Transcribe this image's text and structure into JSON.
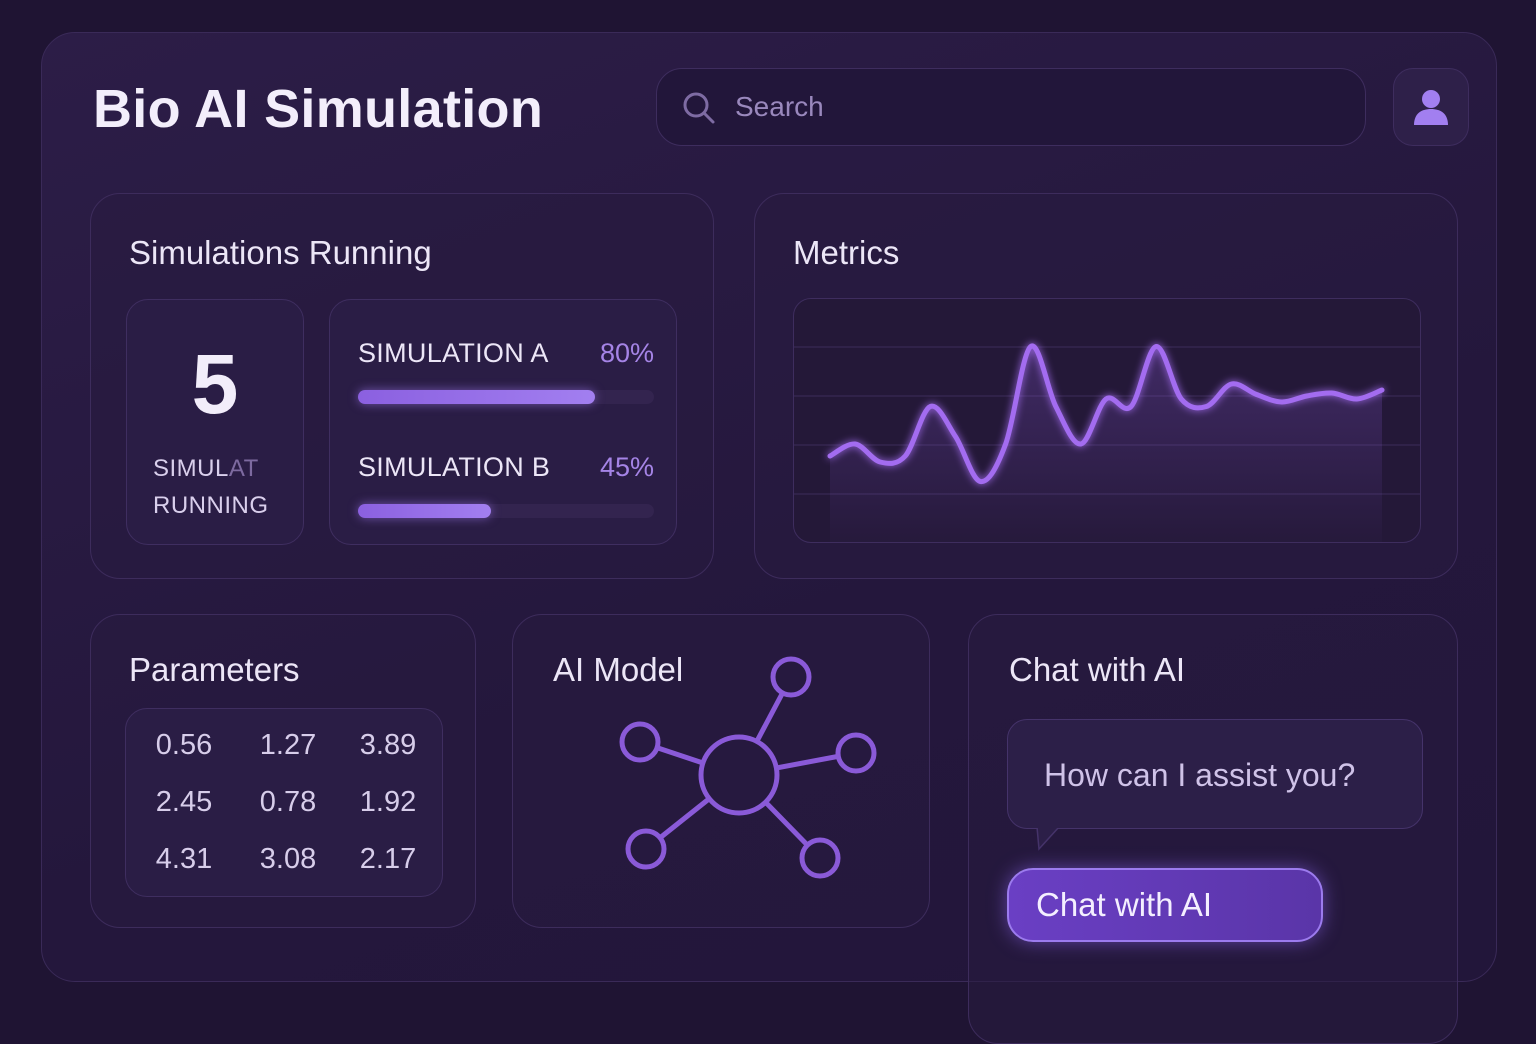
{
  "app": {
    "title": "Bio AI Simulation"
  },
  "search": {
    "placeholder": "Search",
    "icon": "search-icon"
  },
  "profile": {
    "icon": "user-icon"
  },
  "simulations": {
    "title": "Simulations Running",
    "count": "5",
    "count_label_line1_a": "SIMUL",
    "count_label_line1_b": "AT",
    "count_label_line2": "RUNNING",
    "items": [
      {
        "name": "SIMULATION A",
        "percent_label": "80%",
        "progress": 0.8
      },
      {
        "name": "SIMULATION B",
        "percent_label": "45%",
        "progress": 0.45
      }
    ]
  },
  "metrics": {
    "title": "Metrics",
    "chart_data": {
      "type": "line",
      "title": "",
      "xlabel": "",
      "ylabel": "",
      "grid": true,
      "x": [
        0,
        1,
        2,
        3,
        4,
        5,
        6,
        7,
        8,
        9,
        10,
        11,
        12,
        13,
        14,
        15,
        16,
        17,
        18,
        19,
        20,
        21,
        22
      ],
      "series": [
        {
          "values": [
            0.22,
            0.3,
            0.18,
            0.22,
            0.55,
            0.35,
            0.05,
            0.3,
            0.95,
            0.55,
            0.3,
            0.6,
            0.55,
            0.95,
            0.6,
            0.55,
            0.7,
            0.63,
            0.58,
            0.62,
            0.64,
            0.6,
            0.66
          ]
        }
      ],
      "ylim": [
        0,
        1
      ],
      "line_color": "#a36cf0"
    }
  },
  "parameters": {
    "title": "Parameters",
    "rows": [
      [
        "0.56",
        "1.27",
        "3.89"
      ],
      [
        "2.45",
        "0.78",
        "1.92"
      ],
      [
        "4.31",
        "3.08",
        "2.17"
      ]
    ]
  },
  "ai_model": {
    "title": "AI Model",
    "icon": "network-icon",
    "accent": "#8a5ad8"
  },
  "chat": {
    "title": "Chat with AI",
    "prompt": "How can I assist you?",
    "button_label": "Chat with AI"
  },
  "colors": {
    "background": "#1f1433",
    "accent": "#9b6cf0",
    "text": "#ece6f7"
  }
}
